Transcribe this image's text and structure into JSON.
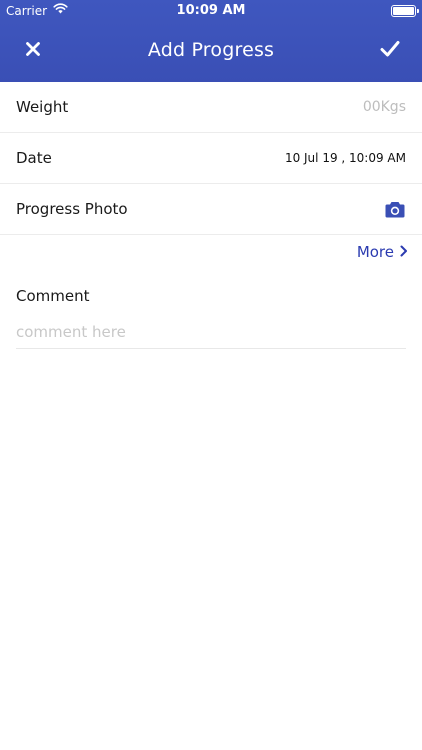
{
  "status_bar": {
    "carrier": "Carrier",
    "time": "10:09 AM"
  },
  "nav": {
    "title": "Add Progress",
    "close_icon": "close-icon",
    "confirm_icon": "checkmark-icon"
  },
  "form": {
    "weight": {
      "label": "Weight",
      "placeholder": "00Kgs"
    },
    "date": {
      "label": "Date",
      "value": "10 Jul 19 , 10:09 AM"
    },
    "photo": {
      "label": "Progress Photo",
      "icon": "camera-icon"
    },
    "more": {
      "label": "More",
      "icon": "chevron-right-icon"
    },
    "comment": {
      "label": "Comment",
      "placeholder": "comment here"
    }
  },
  "colors": {
    "header": "#3a4fb5",
    "accent": "#2b3bb0",
    "placeholder": "#bdbdbd"
  }
}
